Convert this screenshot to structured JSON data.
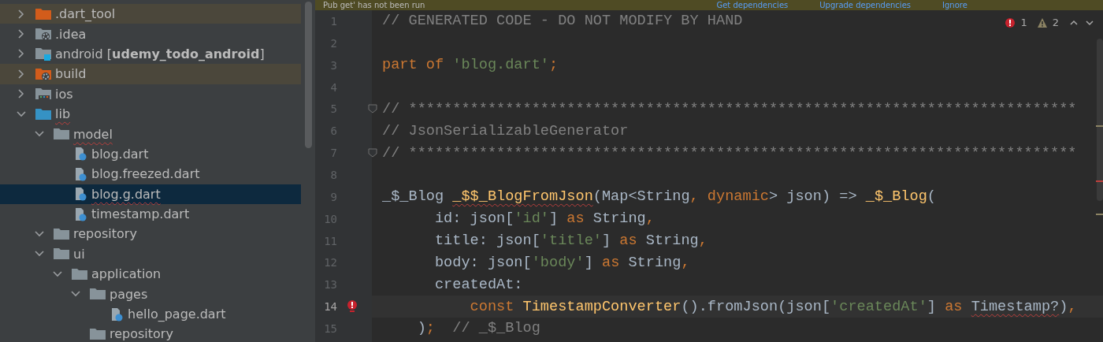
{
  "project_tree": {
    "items": [
      {
        "label": ".dart_tool",
        "kind": "excluded-folder",
        "expanded": false,
        "excluded": true,
        "selected": false,
        "error": false
      },
      {
        "label": ".idea",
        "kind": "config-folder",
        "expanded": false,
        "excluded": false,
        "selected": false,
        "error": false
      },
      {
        "label": "android [**udemy_todo_android**]",
        "kind": "module-folder",
        "expanded": false,
        "excluded": false,
        "selected": false,
        "error": false
      },
      {
        "label": "build",
        "kind": "excluded-config-folder",
        "expanded": false,
        "excluded": true,
        "selected": false,
        "error": false
      },
      {
        "label": "ios",
        "kind": "ios-folder",
        "expanded": false,
        "excluded": false,
        "selected": false,
        "error": false
      },
      {
        "label": "lib",
        "kind": "source-folder",
        "expanded": true,
        "excluded": false,
        "selected": false,
        "error": true,
        "children": [
          {
            "label": "model",
            "kind": "folder",
            "expanded": true,
            "excluded": false,
            "selected": false,
            "error": true,
            "children": [
              {
                "label": "blog.dart",
                "kind": "dart-file",
                "excluded": false,
                "selected": false,
                "error": false
              },
              {
                "label": "blog.freezed.dart",
                "kind": "dart-file",
                "excluded": false,
                "selected": false,
                "error": false
              },
              {
                "label": "blog.g.dart",
                "kind": "dart-file",
                "excluded": false,
                "selected": true,
                "error": true
              },
              {
                "label": "timestamp.dart",
                "kind": "dart-file",
                "excluded": false,
                "selected": false,
                "error": false
              }
            ]
          },
          {
            "label": "repository",
            "kind": "folder",
            "expanded": true,
            "excluded": false,
            "selected": false,
            "error": false
          },
          {
            "label": "ui",
            "kind": "folder",
            "expanded": true,
            "excluded": false,
            "selected": false,
            "error": false,
            "children": [
              {
                "label": "application",
                "kind": "folder",
                "expanded": true,
                "excluded": false,
                "selected": false,
                "error": false,
                "children": [
                  {
                    "label": "pages",
                    "kind": "folder",
                    "expanded": true,
                    "excluded": false,
                    "selected": false,
                    "error": false,
                    "children": [
                      {
                        "label": "hello_page.dart",
                        "kind": "dart-file",
                        "excluded": false,
                        "selected": false,
                        "error": false
                      }
                    ]
                  },
                  {
                    "label": "repository",
                    "kind": "folder",
                    "excluded": false,
                    "selected": false,
                    "error": false
                  }
                ]
              }
            ]
          }
        ]
      }
    ]
  },
  "banner": {
    "message": "Pub get' has not been run",
    "actions": [
      "Get dependencies",
      "Upgrade dependencies",
      "Ignore"
    ]
  },
  "inspections": {
    "errors": "1",
    "warnings": "2"
  },
  "editor": {
    "lines": [
      {
        "number": "1",
        "fold": false,
        "current": false,
        "error": false,
        "tokens": [
          {
            "kind": "comment",
            "text": "// GENERATED CODE - DO NOT MODIFY BY HAND"
          }
        ]
      },
      {
        "number": "2",
        "fold": false,
        "current": false,
        "error": false
      },
      {
        "number": "3",
        "fold": false,
        "current": false,
        "error": false,
        "tokens": [
          {
            "kind": "keyword",
            "text": "part of "
          },
          {
            "kind": "string",
            "text": "'blog.dart'"
          },
          {
            "kind": "keyword",
            "text": ";"
          }
        ]
      },
      {
        "number": "4",
        "fold": false,
        "current": false,
        "error": false
      },
      {
        "number": "5",
        "fold": true,
        "current": false,
        "error": false,
        "tokens": [
          {
            "kind": "comment",
            "text": "// ****************************************************************************"
          }
        ]
      },
      {
        "number": "6",
        "fold": false,
        "current": false,
        "error": false,
        "tokens": [
          {
            "kind": "comment",
            "text": "// JsonSerializableGenerator"
          }
        ]
      },
      {
        "number": "7",
        "fold": true,
        "current": false,
        "error": false,
        "tokens": [
          {
            "kind": "comment",
            "text": "// ****************************************************************************"
          }
        ]
      },
      {
        "number": "8",
        "fold": false,
        "current": false,
        "error": false
      },
      {
        "number": "9",
        "fold": false,
        "current": false,
        "error": false,
        "tokens": [
          {
            "kind": "plain",
            "text": "_$_Blog "
          },
          {
            "kind": "function",
            "text": "_$$_BlogFromJson",
            "squiggle": true
          },
          {
            "kind": "plain",
            "text": "(Map<String"
          },
          {
            "kind": "keyword",
            "text": ", dynamic"
          },
          {
            "kind": "plain",
            "text": "> json) => "
          },
          {
            "kind": "function",
            "text": "_$_Blog"
          },
          {
            "kind": "plain",
            "text": "("
          }
        ]
      },
      {
        "number": "10",
        "fold": false,
        "current": false,
        "error": false,
        "tokens": [
          {
            "kind": "plain",
            "text": "      id: json["
          },
          {
            "kind": "string",
            "text": "'id'"
          },
          {
            "kind": "plain",
            "text": "] "
          },
          {
            "kind": "keyword",
            "text": "as "
          },
          {
            "kind": "plain",
            "text": "String"
          },
          {
            "kind": "keyword",
            "text": ","
          }
        ]
      },
      {
        "number": "11",
        "fold": false,
        "current": false,
        "error": false,
        "tokens": [
          {
            "kind": "plain",
            "text": "      title: json["
          },
          {
            "kind": "string",
            "text": "'title'"
          },
          {
            "kind": "plain",
            "text": "] "
          },
          {
            "kind": "keyword",
            "text": "as "
          },
          {
            "kind": "plain",
            "text": "String"
          },
          {
            "kind": "keyword",
            "text": ","
          }
        ]
      },
      {
        "number": "12",
        "fold": false,
        "current": false,
        "error": false,
        "tokens": [
          {
            "kind": "plain",
            "text": "      body: json["
          },
          {
            "kind": "string",
            "text": "'body'"
          },
          {
            "kind": "plain",
            "text": "] "
          },
          {
            "kind": "keyword",
            "text": "as "
          },
          {
            "kind": "plain",
            "text": "String"
          },
          {
            "kind": "keyword",
            "text": ","
          }
        ]
      },
      {
        "number": "13",
        "fold": false,
        "current": false,
        "error": false,
        "tokens": [
          {
            "kind": "plain",
            "text": "      createdAt:"
          }
        ]
      },
      {
        "number": "14",
        "fold": false,
        "current": true,
        "error": true,
        "tokens": [
          {
            "kind": "keyword",
            "text": "          const "
          },
          {
            "kind": "function",
            "text": "TimestampConverter"
          },
          {
            "kind": "plain",
            "text": "().fromJson(json["
          },
          {
            "kind": "string",
            "text": "'createdAt'"
          },
          {
            "kind": "plain",
            "text": "] "
          },
          {
            "kind": "keyword",
            "text": "as "
          },
          {
            "kind": "plain",
            "text": "Timestamp?",
            "squiggle": true
          },
          {
            "kind": "plain",
            "text": ")"
          },
          {
            "kind": "keyword",
            "text": ","
          }
        ]
      },
      {
        "number": "15",
        "fold": false,
        "current": false,
        "error": false,
        "tokens": [
          {
            "kind": "plain",
            "text": "    )"
          },
          {
            "kind": "keyword",
            "text": ";"
          },
          {
            "kind": "comment",
            "text": "  // _$_Blog"
          }
        ]
      }
    ]
  }
}
